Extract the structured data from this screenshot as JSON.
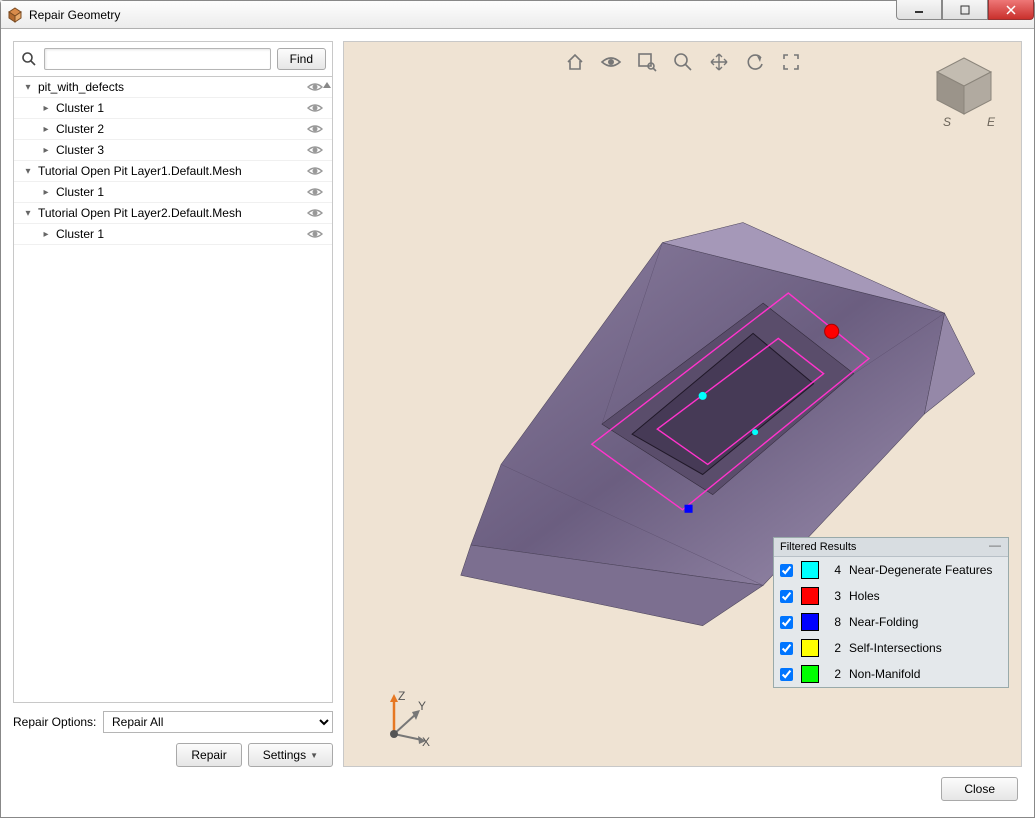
{
  "window": {
    "title": "Repair Geometry"
  },
  "search": {
    "placeholder": "",
    "button": "Find"
  },
  "tree": {
    "nodes": [
      {
        "level": 0,
        "twist": "▾",
        "label": "pit_with_defects"
      },
      {
        "level": 1,
        "twist": "▸",
        "label": "Cluster 1"
      },
      {
        "level": 1,
        "twist": "▸",
        "label": "Cluster 2"
      },
      {
        "level": 1,
        "twist": "▸",
        "label": "Cluster 3"
      },
      {
        "level": 0,
        "twist": "▾",
        "label": "Tutorial Open Pit Layer1.Default.Mesh"
      },
      {
        "level": 1,
        "twist": "▸",
        "label": "Cluster 1"
      },
      {
        "level": 0,
        "twist": "▾",
        "label": "Tutorial Open Pit Layer2.Default.Mesh"
      },
      {
        "level": 1,
        "twist": "▸",
        "label": "Cluster 1"
      }
    ]
  },
  "repair": {
    "options_label": "Repair Options:",
    "selected": "Repair All",
    "repair_btn": "Repair",
    "settings_btn": "Settings"
  },
  "filter": {
    "title": "Filtered Results",
    "items": [
      {
        "count": "4",
        "label": "Near-Degenerate Features",
        "color": "#00ffff"
      },
      {
        "count": "3",
        "label": "Holes",
        "color": "#ff0000"
      },
      {
        "count": "8",
        "label": "Near-Folding",
        "color": "#0000ff"
      },
      {
        "count": "2",
        "label": "Self-Intersections",
        "color": "#ffff00"
      },
      {
        "count": "2",
        "label": "Non-Manifold",
        "color": "#00ff00"
      }
    ]
  },
  "axes": {
    "x": "X",
    "y": "Y",
    "z": "Z"
  },
  "compass": {
    "s": "S",
    "e": "E"
  },
  "footer": {
    "close": "Close"
  }
}
